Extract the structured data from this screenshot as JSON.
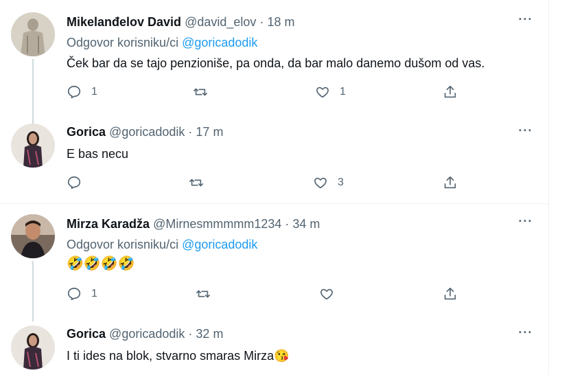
{
  "tweets": [
    {
      "name": "Mikelanđelov David",
      "handle": "@david_elov",
      "time": "18 m",
      "replying_prefix": "Odgovor korisniku/ci",
      "replying_mention": "@goricadodik",
      "text": "Ček bar da se tajo penzioniše, pa onda, da bar malo danemo dušom od vas.",
      "reply_count": "1",
      "retweet_count": "",
      "like_count": "1"
    },
    {
      "name": "Gorica",
      "handle": "@goricadodik",
      "time": "17 m",
      "text": "E bas necu",
      "reply_count": "",
      "retweet_count": "",
      "like_count": "3"
    },
    {
      "name": "Mirza Karadža",
      "handle": "@Mirnesmmmmm1234",
      "time": "34 m",
      "replying_prefix": "Odgovor korisniku/ci",
      "replying_mention": "@goricadodik",
      "text": "🤣🤣🤣🤣",
      "reply_count": "1",
      "retweet_count": "",
      "like_count": ""
    },
    {
      "name": "Gorica",
      "handle": "@goricadodik",
      "time": "32 m",
      "text": "I ti ides na blok, stvarno smaras Mirza",
      "text_emoji": "😘",
      "reply_count": "",
      "retweet_count": "",
      "like_count": ""
    }
  ],
  "separator_dot": "·",
  "more_label": "···",
  "icons": [
    "reply-icon",
    "retweet-icon",
    "like-icon",
    "share-icon",
    "more-icon"
  ],
  "colors": {
    "accent": "#1d9bf0",
    "secondary_text": "#536471",
    "primary_text": "#0f1419"
  }
}
